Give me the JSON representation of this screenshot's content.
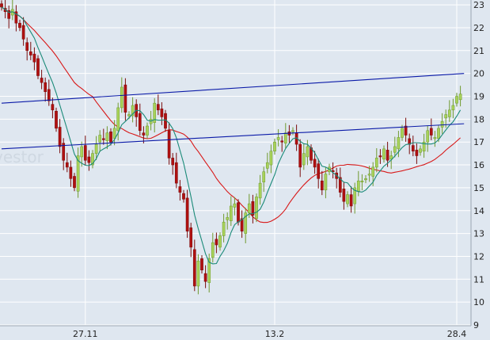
{
  "chart_data": {
    "type": "candlestick",
    "title": "",
    "xlabel": "",
    "ylabel": "",
    "ylim": [
      9,
      23
    ],
    "y_ticks": [
      9,
      10,
      11,
      12,
      13,
      14,
      15,
      16,
      17,
      18,
      19,
      20,
      21,
      22,
      23
    ],
    "x_ticks": [
      {
        "label": "27.11",
        "index": 23
      },
      {
        "label": "13.2",
        "index": 75
      },
      {
        "label": "28.4",
        "index": 125
      }
    ],
    "grid": true,
    "watermark": "vestor",
    "colors": {
      "background": "#dfe7f0",
      "grid": "#ffffff",
      "up_candle": "#a8d25a",
      "down_candle": "#b01010",
      "ma_short": "#1a8a78",
      "ma_long": "#d81818",
      "trendline": "#0a1aa8"
    },
    "trendlines": [
      {
        "x1": 0,
        "y1": 18.7,
        "x2": 127,
        "y2": 20.0
      },
      {
        "x1": 0,
        "y1": 16.7,
        "x2": 127,
        "y2": 17.8
      }
    ],
    "closes": [
      22.9,
      22.7,
      22.4,
      22.8,
      22.2,
      22.0,
      21.5,
      21.0,
      20.8,
      20.5,
      19.9,
      19.6,
      19.2,
      18.8,
      18.4,
      17.6,
      16.8,
      16.2,
      15.9,
      15.4,
      15.0,
      16.4,
      16.8,
      16.2,
      16.1,
      16.5,
      16.9,
      17.3,
      17.1,
      17.4,
      17.0,
      17.6,
      18.5,
      19.4,
      18.3,
      18.2,
      18.6,
      18.1,
      17.5,
      17.3,
      17.7,
      18.0,
      18.7,
      18.4,
      18.1,
      17.6,
      16.3,
      16.0,
      15.2,
      14.8,
      14.5,
      13.1,
      12.4,
      10.7,
      11.8,
      11.4,
      10.9,
      11.9,
      12.6,
      12.5,
      12.9,
      13.5,
      13.7,
      14.2,
      14.3,
      13.5,
      13.1,
      13.9,
      14.3,
      13.8,
      14.6,
      15.2,
      15.7,
      16.1,
      16.6,
      17.0,
      17.2,
      17.0,
      17.4,
      17.3,
      17.5,
      16.9,
      15.9,
      16.5,
      16.8,
      16.2,
      15.9,
      15.4,
      14.9,
      15.6,
      15.9,
      15.7,
      15.4,
      14.8,
      14.4,
      14.7,
      14.2,
      15.0,
      15.3,
      15.3,
      15.4,
      15.6,
      15.9,
      16.3,
      16.4,
      16.7,
      16.2,
      16.4,
      16.8,
      17.2,
      17.6,
      17.3,
      16.9,
      16.6,
      16.4,
      16.7,
      17.0,
      17.5,
      17.3,
      17.2,
      17.6,
      17.9,
      18.2,
      18.4,
      18.6,
      19.0,
      19.1
    ]
  }
}
